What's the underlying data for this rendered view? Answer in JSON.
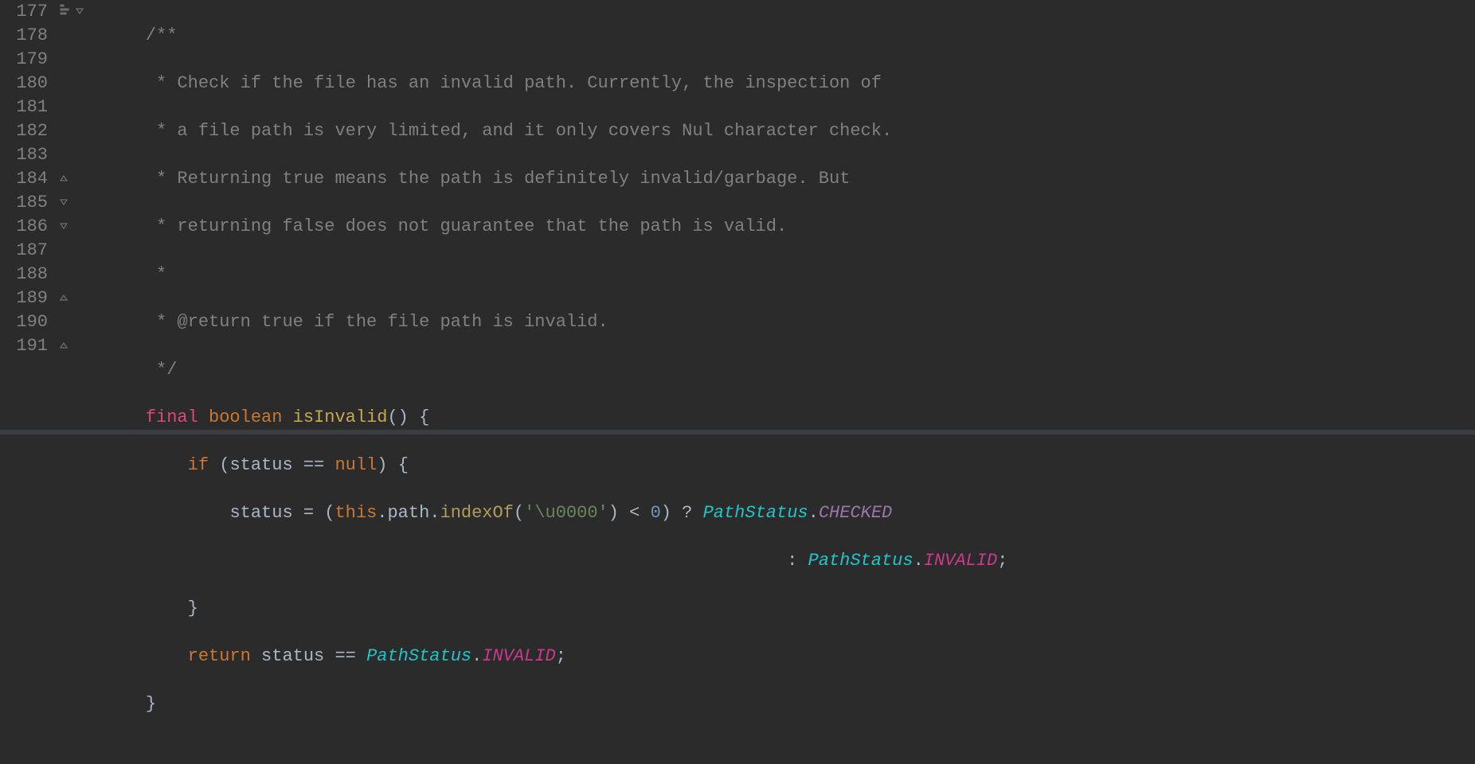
{
  "gutter": {
    "start": 177,
    "end": 191,
    "numbers": [
      "177",
      "178",
      "179",
      "180",
      "181",
      "182",
      "183",
      "184",
      "185",
      "186",
      "187",
      "188",
      "189",
      "190",
      "191"
    ]
  },
  "icons": {
    "structure": "structure-icon",
    "fold_open": "fold-open-icon",
    "fold_close": "fold-close-icon"
  },
  "code": {
    "l177": {
      "indent": "    ",
      "c1": "/**"
    },
    "l178": {
      "indent": "     ",
      "c1": "* Check if the file has an invalid path. Currently, the inspection of"
    },
    "l179": {
      "indent": "     ",
      "c1": "* a file path is very limited, and it only covers Nul character check."
    },
    "l180": {
      "indent": "     ",
      "c1": "* Returning true means the path is definitely invalid/garbage. But"
    },
    "l181": {
      "indent": "     ",
      "c1": "* returning false does not guarantee that the path is valid."
    },
    "l182": {
      "indent": "     ",
      "c1": "*"
    },
    "l183": {
      "indent": "     ",
      "c1": "* @return true if the file path is invalid."
    },
    "l184": {
      "indent": "     ",
      "c1": "*/"
    },
    "l185": {
      "indent": "    ",
      "kw_final": "final",
      "sp": " ",
      "kw_bool": "boolean",
      "sp2": " ",
      "mname": "isInvalid",
      "paren": "()",
      "sp3": " ",
      "brace": "{"
    },
    "l186": {
      "indent": "        ",
      "kw_if": "if",
      "sp": " ",
      "lp": "(",
      "id": "status",
      "sp2": " ",
      "op": "==",
      "sp3": " ",
      "null": "null",
      "rp": ")",
      "sp4": " ",
      "brace": "{"
    },
    "l187": {
      "indent": "            ",
      "id": "status",
      "sp": " ",
      "op": "=",
      "sp2": " ",
      "lp": "(",
      "this": "this",
      "dot1": ".",
      "path": "path",
      "dot2": ".",
      "call": "indexOf",
      "lp2": "(",
      "str": "'\\u0000'",
      "rp2": ")",
      "sp3": " ",
      "lt": "<",
      "sp4": " ",
      "zero": "0",
      "rp": ")",
      "sp5": " ",
      "q": "?",
      "sp6": " ",
      "enum": "PathStatus",
      "dot3": ".",
      "val": "CHECKED"
    },
    "l188": {
      "indent": "                                                                 ",
      "colon": ":",
      "sp": " ",
      "enum": "PathStatus",
      "dot": ".",
      "val": "INVALID",
      "semi": ";"
    },
    "l189": {
      "indent": "        ",
      "brace": "}"
    },
    "l190": {
      "indent": "        ",
      "kw": "return",
      "sp": " ",
      "id": "status",
      "sp2": " ",
      "op": "==",
      "sp3": " ",
      "enum": "PathStatus",
      "dot": ".",
      "val": "INVALID",
      "semi": ";"
    },
    "l191": {
      "indent": "    ",
      "brace": "}"
    }
  }
}
